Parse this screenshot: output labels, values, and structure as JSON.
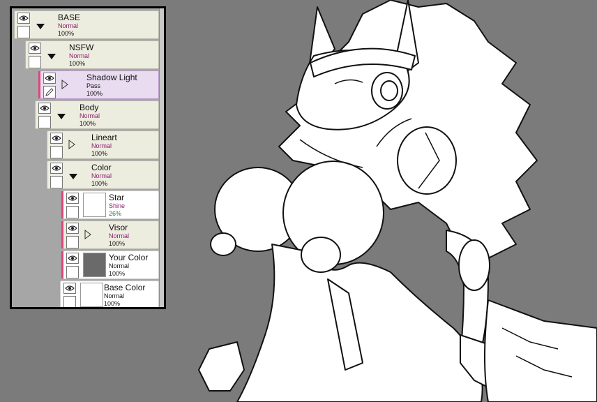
{
  "colors": {
    "canvas_bg": "#7b7b7b",
    "panel_border": "#000000",
    "layer_bg": "#ececdf",
    "layer_selected_bg": "#e9dcf0",
    "group_marker": "#e0447d",
    "blend_mode_text": "#8a1a6e"
  },
  "layers": [
    {
      "name": "BASE",
      "mode": "Normal",
      "opacity": "100%",
      "type": "folder-open"
    },
    {
      "name": "NSFW",
      "mode": "Normal",
      "opacity": "100%",
      "type": "folder-open"
    },
    {
      "name": "Shadow Light",
      "mode": "Pass",
      "opacity": "100%",
      "type": "folder-closed",
      "selected": true
    },
    {
      "name": "Body",
      "mode": "Normal",
      "opacity": "100%",
      "type": "folder-open"
    },
    {
      "name": "Lineart",
      "mode": "Normal",
      "opacity": "100%",
      "type": "folder-closed"
    },
    {
      "name": "Color",
      "mode": "Normal",
      "opacity": "100%",
      "type": "folder-open"
    },
    {
      "name": "Star",
      "mode": "Shine",
      "opacity": "26%",
      "type": "layer"
    },
    {
      "name": "Visor",
      "mode": "Normal",
      "opacity": "100%",
      "type": "folder-closed"
    },
    {
      "name": "Your Color",
      "mode": "Normal",
      "opacity": "100%",
      "type": "layer"
    },
    {
      "name": "Base Color",
      "mode": "Normal",
      "opacity": "100%",
      "type": "layer"
    }
  ],
  "icons": {
    "visibility": "eye-icon",
    "edit": "pencil-icon",
    "folder_open": "triangle-down-icon",
    "folder_closed": "triangle-right-icon"
  }
}
